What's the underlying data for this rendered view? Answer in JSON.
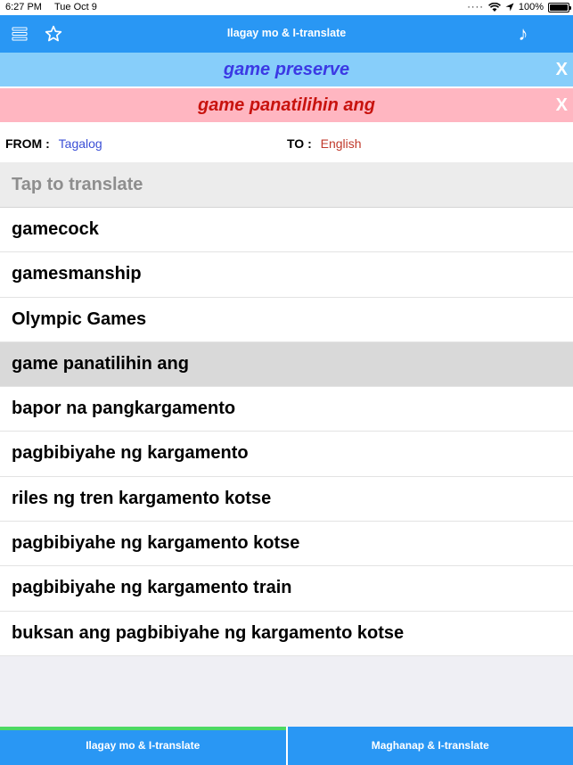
{
  "status": {
    "time": "6:27 PM",
    "date": "Tue Oct 9",
    "battery": "100%",
    "battery_level": 1.0
  },
  "nav": {
    "title": "Ilagay mo & I-translate",
    "left_icons": [
      "menu-icon",
      "star-icon"
    ],
    "right_icon": "music-note-icon"
  },
  "results": {
    "english": "game preserve",
    "tagalog": "game panatilihin ang",
    "close_label": "X",
    "colors": {
      "english_bg": "#87cefa",
      "english_text": "#3b39e4",
      "tagalog_bg": "#ffb6c1",
      "tagalog_text": "#c8130e"
    }
  },
  "languages": {
    "from_label": "FROM :",
    "from_value": "Tagalog",
    "to_label": "TO :",
    "to_value": "English"
  },
  "input": {
    "placeholder": "Tap to translate"
  },
  "list": {
    "items": [
      "gamecock",
      "gamesmanship",
      "Olympic Games",
      "game panatilihin ang",
      "bapor na pangkargamento",
      "pagbibiyahe ng kargamento",
      "riles ng tren kargamento kotse",
      "pagbibiyahe ng kargamento kotse",
      "pagbibiyahe ng kargamento train",
      "buksan ang pagbibiyahe ng kargamento kotse"
    ],
    "selected_index": 3
  },
  "tabs": [
    {
      "label": "Ilagay mo & I-translate",
      "active": true
    },
    {
      "label": "Maghanap & I-translate",
      "active": false
    }
  ],
  "colors": {
    "accent": "#2997f4",
    "active_tab_indicator": "#4cd964"
  }
}
